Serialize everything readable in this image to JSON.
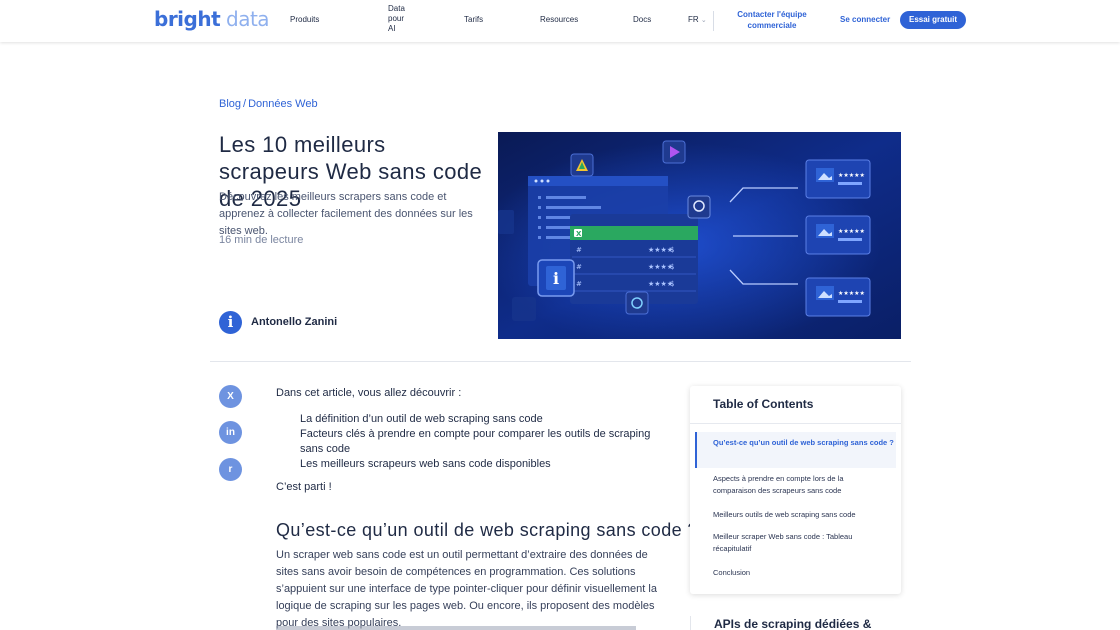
{
  "header": {
    "logo_part1": "bright",
    "logo_part2": " data",
    "nav": [
      "Produits",
      "Data pour AI",
      "Tarifs",
      "Resources",
      "Docs"
    ],
    "lang": "FR",
    "contact": "Contacter l'équipe commerciale",
    "login": "Se connecter",
    "trial": "Essai gratuit"
  },
  "hero": {
    "breadcrumb_root": "Blog",
    "breadcrumb_sep": "/",
    "breadcrumb_current": "Données Web",
    "title": "Les 10 meilleurs scrapeurs Web sans code de 2025",
    "subtitle": "Découvrez les meilleurs scrapers sans code et apprenez à collecter facilement des données sur les sites web.",
    "read_time": "16 min de lecture",
    "author": "Antonello Zanini"
  },
  "share": {
    "x": "X",
    "linkedin": "in",
    "reddit": "r"
  },
  "article": {
    "intro": "Dans cet article, vous allez découvrir :",
    "bullets": [
      "La définition d’un outil de web scraping sans code",
      "Facteurs clés à prendre en compte pour comparer les outils de scraping sans code",
      "Les meilleurs scrapeurs web sans code disponibles"
    ],
    "outro": "C’est parti !",
    "h2": "Qu’est-ce qu’un outil de web scraping sans code ?",
    "paragraph": "Un scraper web sans code est un outil permettant d’extraire des données de sites sans avoir besoin de compétences en programmation. Ces solutions s’appuient sur une interface de type pointer-cliquer pour définir visuellement la logique de scraping sur les pages web. Ou encore, ils proposent des modèles pour des sites populaires."
  },
  "toc": {
    "title": "Table of Contents",
    "items": [
      "Qu’est-ce qu’un outil de web scraping sans code ?",
      "Aspects à prendre en compte lors de la comparaison des scrapeurs sans code",
      "Meilleurs outils de web scraping sans code",
      "Meilleur scraper Web sans code : Tableau récapitulatif",
      "Conclusion"
    ],
    "next_section": "APIs de scraping dédiées &"
  },
  "colors": {
    "brand_blue": "#2f63d6",
    "text_dark": "#1f2a44",
    "hero_bg": "#0c1f63"
  }
}
